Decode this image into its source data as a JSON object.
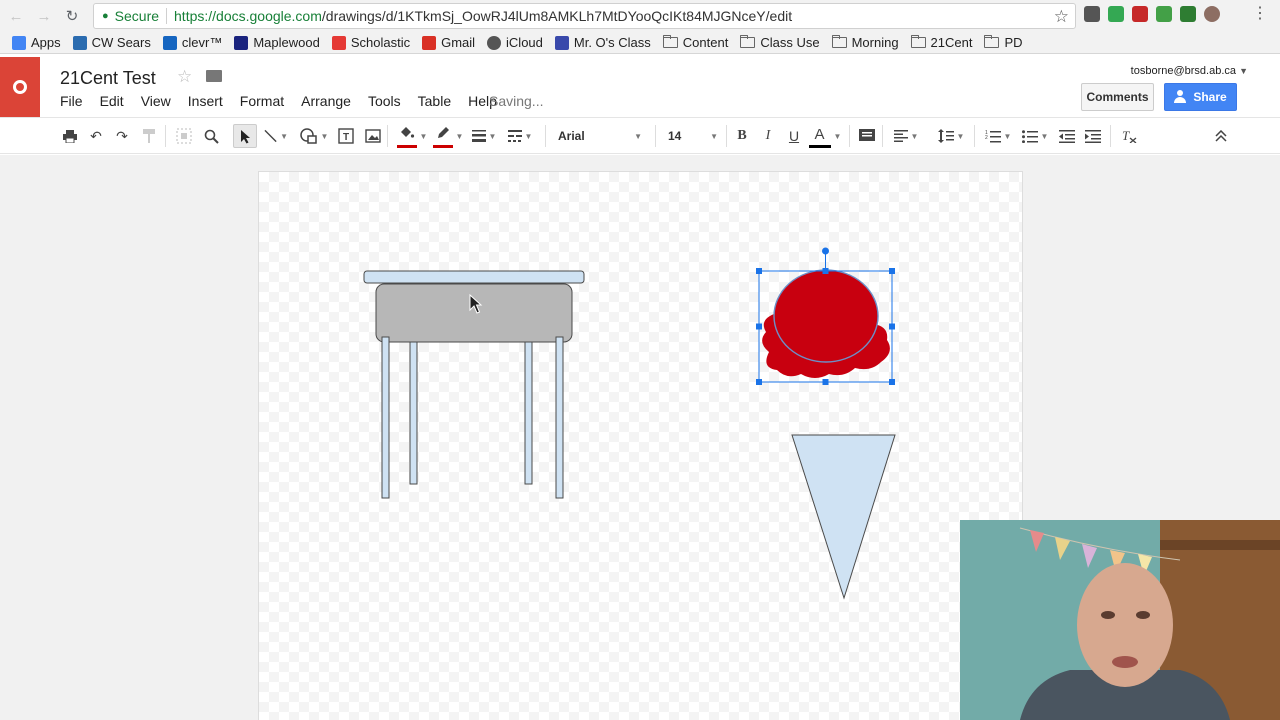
{
  "browser": {
    "secure_label": "Secure",
    "url_host": "https://docs.google.com",
    "url_path": "/drawings/d/1KTkmSj_OowRJ4lUm8AMKLh7MtDYooQcIKt84MJGNceY/edit",
    "icons": {
      "back": "back-arrow-icon",
      "forward": "forward-arrow-icon",
      "reload": "reload-icon",
      "bookmark": "star-icon",
      "menu": "kebab-menu-icon"
    }
  },
  "bookmarks": [
    {
      "label": "Apps",
      "icon": "apps-grid-icon",
      "color": "#4285f4"
    },
    {
      "label": "CW Sears",
      "icon": "sears-logo-icon",
      "color": "#2b6cb0"
    },
    {
      "label": "clevr™",
      "icon": "clever-logo-icon",
      "color": "#1565c0"
    },
    {
      "label": "Maplewood",
      "icon": "maplewood-logo-icon",
      "color": "#1a237e"
    },
    {
      "label": "Scholastic",
      "icon": "scholastic-logo-icon",
      "color": "#e53935"
    },
    {
      "label": "Gmail",
      "icon": "gmail-icon",
      "color": "#d93025"
    },
    {
      "label": "iCloud",
      "icon": "apple-icon",
      "color": "#555555"
    },
    {
      "label": "Mr. O's Class",
      "icon": "calendar-icon",
      "color": "#3949ab"
    },
    {
      "label": "Content",
      "icon": "folder-icon"
    },
    {
      "label": "Class Use",
      "icon": "folder-icon"
    },
    {
      "label": "Morning",
      "icon": "folder-icon"
    },
    {
      "label": "21Cent",
      "icon": "folder-icon"
    },
    {
      "label": "PD",
      "icon": "folder-icon"
    }
  ],
  "doc": {
    "title": "21Cent Test",
    "status": "Saving...",
    "user_email": "tosborne@brsd.ab.ca",
    "comments_label": "Comments",
    "share_label": "Share",
    "menus": [
      "File",
      "Edit",
      "View",
      "Insert",
      "Format",
      "Arrange",
      "Tools",
      "Table",
      "Help"
    ]
  },
  "toolbar": {
    "font": "Arial",
    "font_size": "14",
    "bold": "B",
    "italic": "I",
    "underline": "U",
    "text_color": "A",
    "fill_color": "#cc0000",
    "line_color": "#cc0000",
    "text_color_value": "#000000"
  },
  "colors": {
    "accent": "#4285f4",
    "logo": "#db4437",
    "scoop": "#c8000f",
    "cone": "#cfe2f3",
    "desk_top": "#cfe2f3",
    "desk_body": "#b7b7b7",
    "selection": "#1a73e8"
  }
}
